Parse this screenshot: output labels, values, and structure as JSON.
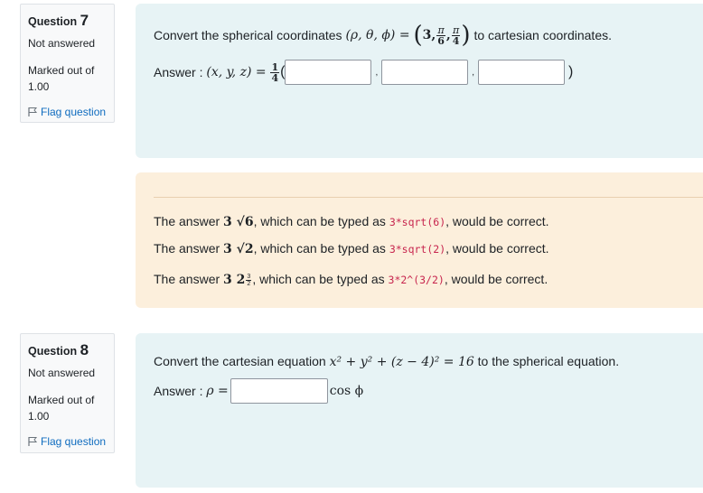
{
  "questions": [
    {
      "label": "Question",
      "number": "7",
      "state": "Not answered",
      "grade_label": "Marked out of",
      "grade_value": "1.00",
      "flag_label": "Flag question",
      "prompt_before": "Convert the spherical coordinates",
      "prompt_after": "to cartesian coordinates.",
      "answer_label": "Answer :",
      "math": {
        "coords_vars": "(ρ, θ, ϕ) =",
        "value_lead": "3,",
        "frac1_num": "π",
        "frac1_den": "6",
        "frac2_num": "π",
        "frac2_den": "4",
        "answer_vars": "(x, y, z) =",
        "coef_num": "1",
        "coef_den": "4"
      },
      "inputs": [
        "",
        "",
        ""
      ]
    },
    {
      "label": "Question",
      "number": "8",
      "state": "Not answered",
      "grade_label": "Marked out of",
      "grade_value": "1.00",
      "flag_label": "Flag question",
      "prompt_before": "Convert the cartesian equation",
      "prompt_after": "to the spherical equation.",
      "answer_label": "Answer :",
      "math": {
        "equation": "x² + y² + (z − 4)² = 16",
        "rho": "ρ =",
        "cos_phi": "cos ϕ"
      },
      "inputs": [
        ""
      ]
    }
  ],
  "feedback": [
    {
      "prefix": "The answer",
      "math": "3 √6",
      "mid": ", which can be typed as",
      "code": "3*sqrt(6)",
      "suffix": ", would be correct."
    },
    {
      "prefix": "The answer",
      "math": "3 √2",
      "mid": ", which can be typed as",
      "code": "3*sqrt(2)",
      "suffix": ", would be correct."
    },
    {
      "prefix": "The answer",
      "math": "3 2",
      "math_exp_num": "3",
      "math_exp_den": "2",
      "mid": ", which can be typed as",
      "code": "3*2^(3/2)",
      "suffix": ", would be correct."
    }
  ],
  "colors": {
    "link": "#0f6cbf",
    "formulation_bg": "#e7f3f5",
    "feedback_bg": "#fcefdc",
    "code": "#c7254e"
  },
  "icons": {
    "flag": "flag-icon"
  }
}
